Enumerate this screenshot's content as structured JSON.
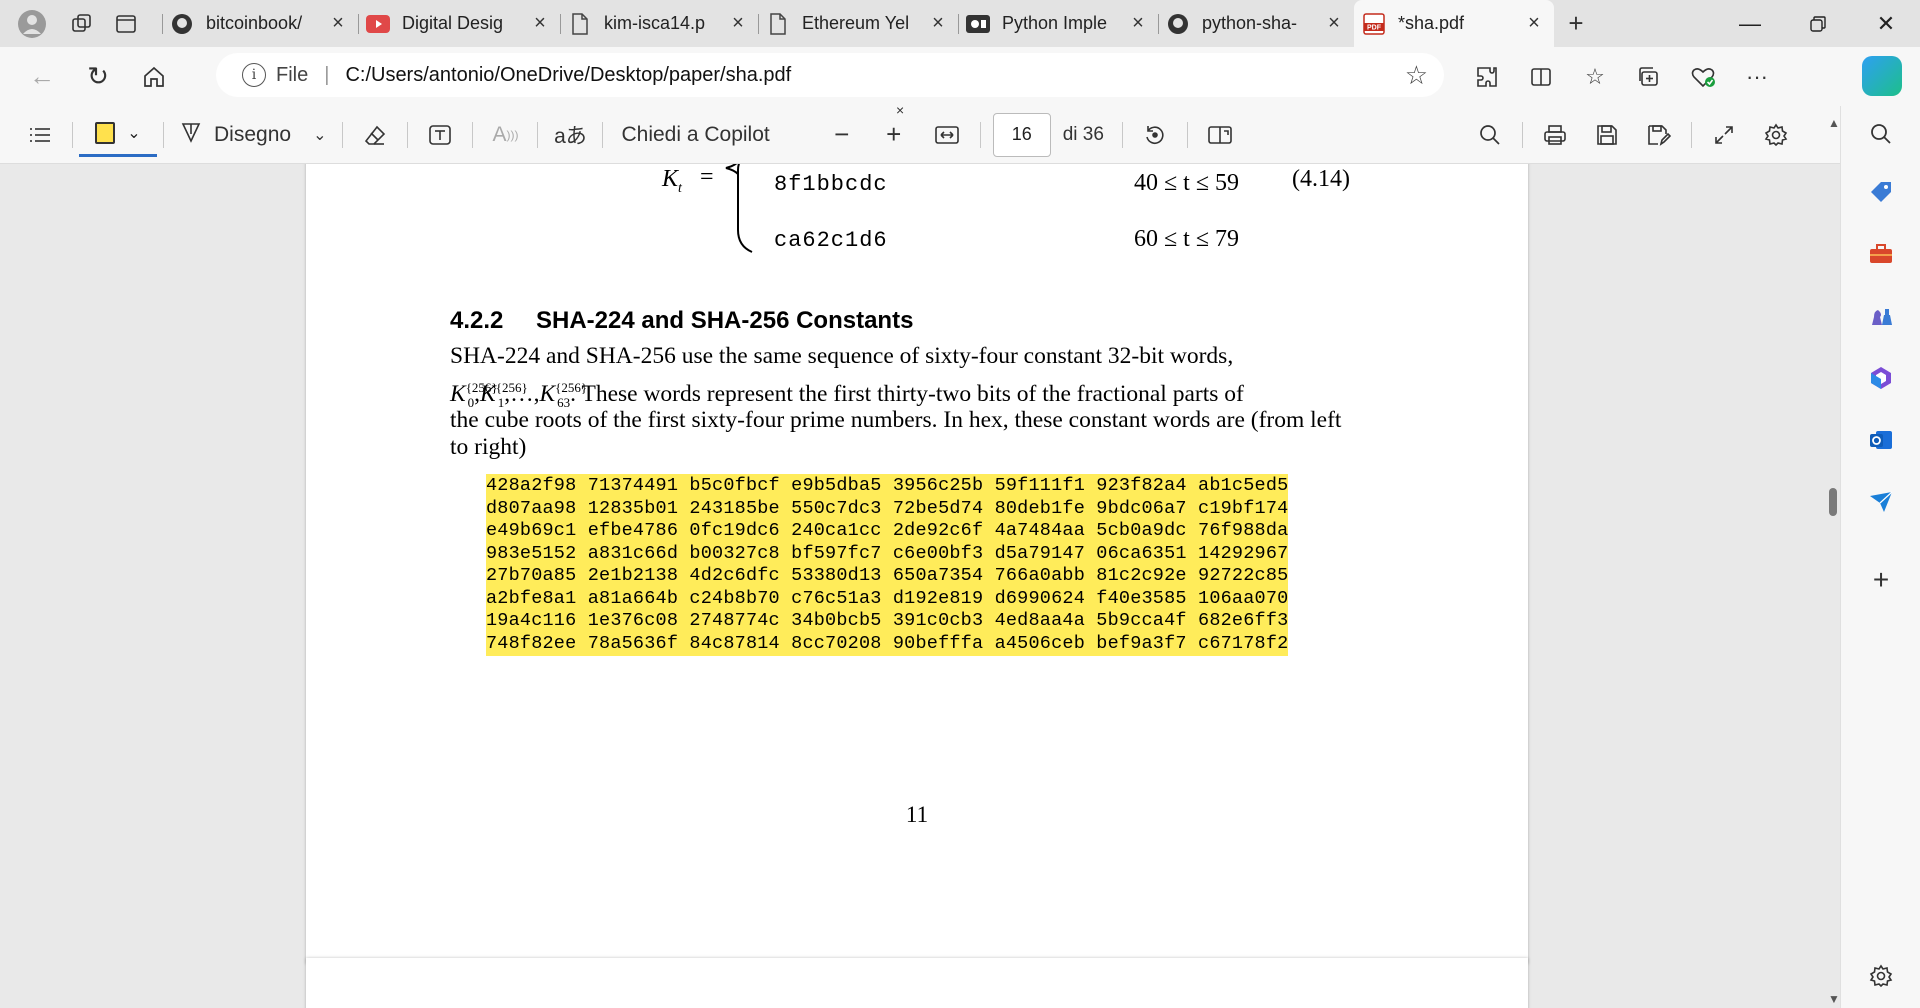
{
  "tabs": [
    {
      "title": "bitcoinbook/",
      "icon": "github-icon",
      "active": false
    },
    {
      "title": "Digital Desig",
      "icon": "youtube-icon",
      "active": false
    },
    {
      "title": "kim-isca14.p",
      "icon": "document-icon",
      "active": false
    },
    {
      "title": "Ethereum Yel",
      "icon": "document-icon",
      "active": false
    },
    {
      "title": "Python Imple",
      "icon": "media-icon",
      "active": false
    },
    {
      "title": "python-sha-",
      "icon": "github-icon",
      "active": false
    },
    {
      "title": "*sha.pdf",
      "icon": "pdf-icon",
      "active": true
    }
  ],
  "address": {
    "scheme": "File",
    "url": "C:/Users/antonio/OneDrive/Desktop/paper/sha.pdf"
  },
  "pdf_toolbar": {
    "draw_label": "Disegno",
    "copilot_label": "Chiedi a Copilot",
    "page_current": "16",
    "page_total": "di 36",
    "read_aloud_glyph": "A",
    "translate_glyph": "aあ",
    "close_glyph": "×"
  },
  "document": {
    "eq_lhs": "K",
    "eq_lhs_sub": "t",
    "eq_sign": "=",
    "eq_number": "(4.14)",
    "k_rows": [
      {
        "value": "8f1bbcdc",
        "range": "40 ≤ t ≤ 59"
      },
      {
        "value": "ca62c1d6",
        "range": "60 ≤ t ≤ 79"
      }
    ],
    "section_number": "4.2.2",
    "section_title": "SHA-224 and SHA-256 Constants",
    "para_line1": "SHA-224 and SHA-256 use the same sequence of sixty-four constant 32-bit words,",
    "para_line2_math": {
      "sym": "K",
      "sup": "{256}",
      "subs": [
        "0",
        "1",
        "63"
      ],
      "sep1": ",",
      "sep2": ",…,"
    },
    "para_line2_rest": ".  These words represent the first thirty-two bits of the fractional parts of",
    "para_line3": "the cube roots of the first sixty-four prime numbers.  In hex, these constant words are (from left",
    "para_line4": "to right)",
    "hex_rows": [
      "428a2f98 71374491 b5c0fbcf e9b5dba5 3956c25b 59f111f1 923f82a4 ab1c5ed5",
      "d807aa98 12835b01 243185be 550c7dc3 72be5d74 80deb1fe 9bdc06a7 c19bf174",
      "e49b69c1 efbe4786 0fc19dc6 240ca1cc 2de92c6f 4a7484aa 5cb0a9dc 76f988da",
      "983e5152 a831c66d b00327c8 bf597fc7 c6e00bf3 d5a79147 06ca6351 14292967",
      "27b70a85 2e1b2138 4d2c6dfc 53380d13 650a7354 766a0abb 81c2c92e 92722c85",
      "a2bfe8a1 a81a664b c24b8b70 c76c51a3 d192e819 d6990624 f40e3585 106aa070",
      "19a4c116 1e376c08 2748774c 34b0bcb5 391c0cb3 4ed8aa4a 5b9cca4f 682e6ff3",
      "748f82ee 78a5636f 84c87814 8cc70208 90befffa a4506ceb bef9a3f7 c67178f2"
    ],
    "page_number": "11"
  },
  "colors": {
    "highlight": "#ffec5a",
    "accent": "#2b6cc4"
  }
}
